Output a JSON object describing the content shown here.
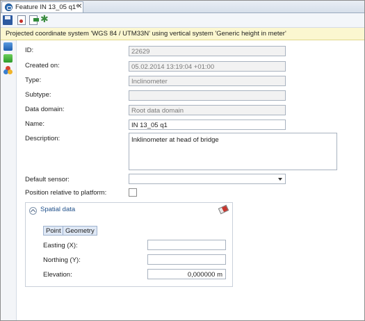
{
  "tab": {
    "title": "Feature IN 13_05 q1*",
    "close": "✕",
    "icon": "feature-icon"
  },
  "toolbar": {
    "save_icon": "save-icon",
    "doc_icon": "document-icon",
    "export_icon": "export-icon",
    "star_icon": "star-icon",
    "star_glyph": "✱"
  },
  "banner": {
    "text": "Projected coordinate system 'WGS 84 / UTM33N' using vertical system 'Generic height in meter'"
  },
  "form": {
    "id_label": "ID:",
    "id_value": "22629",
    "created_label": "Created on:",
    "created_value": "05.02.2014 13:19:04 +01:00",
    "type_label": "Type:",
    "type_value": "Inclinometer",
    "subtype_label": "Subtype:",
    "subtype_value": "",
    "domain_label": "Data domain:",
    "domain_value": "Root data domain",
    "name_label": "Name:",
    "name_value": "IN 13_05 q1",
    "desc_label": "Description:",
    "desc_value": "Inklinometer at head of bridge",
    "sensor_label": "Default sensor:",
    "sensor_value": "",
    "position_label": "Position relative to platform:"
  },
  "spatial": {
    "title": "Spatial data",
    "tab_point": "Point",
    "tab_geometry": "Geometry",
    "easting_label": "Easting (X):",
    "easting_value": "",
    "northing_label": "Northing (Y):",
    "northing_value": "",
    "elevation_label": "Elevation:",
    "elevation_value": "0,000000 m"
  }
}
